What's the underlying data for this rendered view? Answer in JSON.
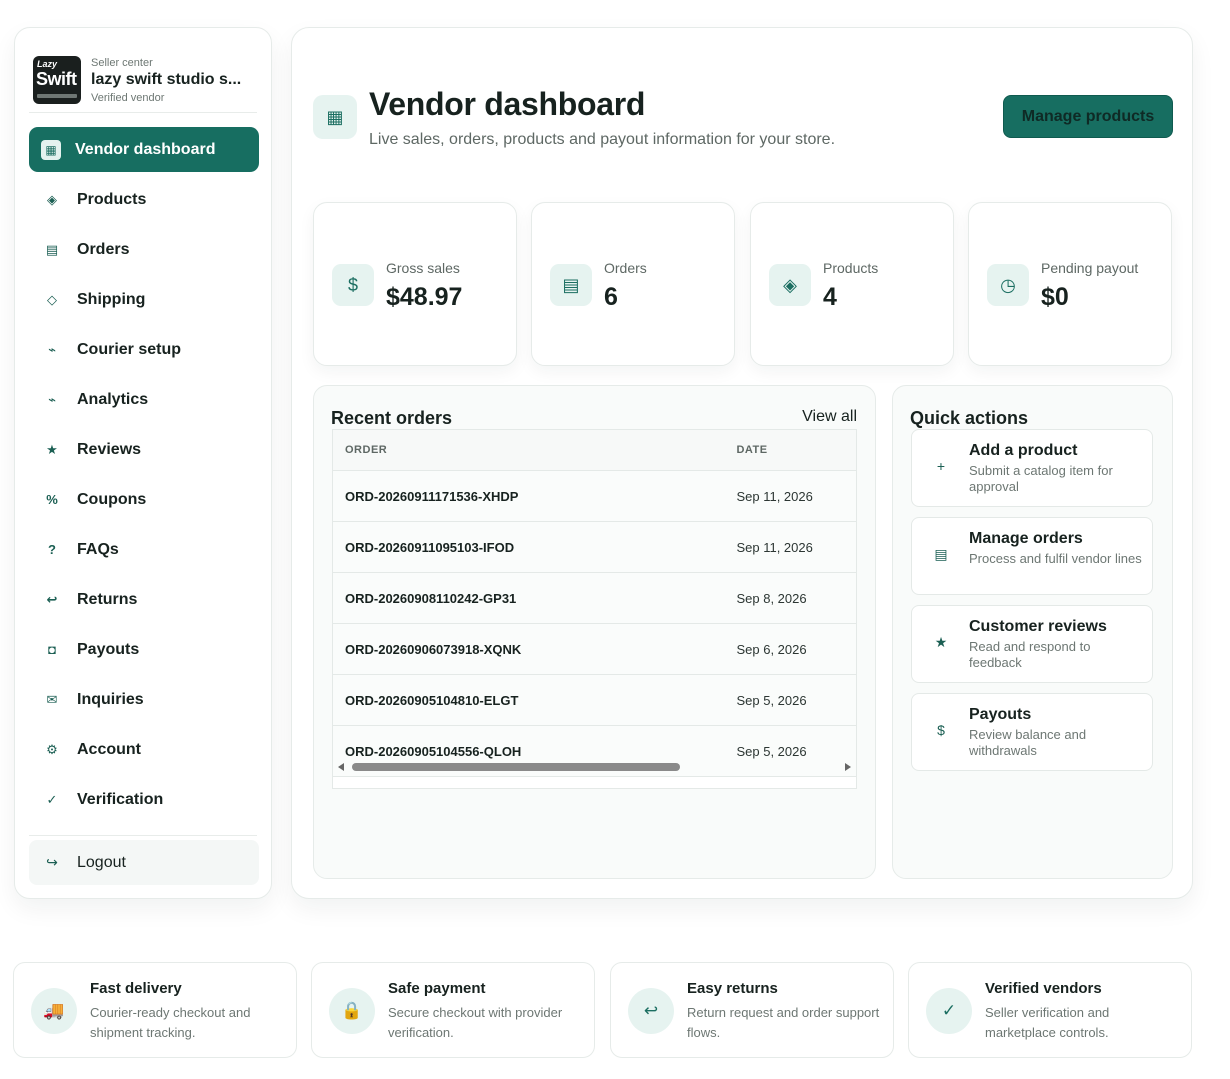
{
  "brand": {
    "logo_top": "Lazy",
    "logo_main": "Swift",
    "kicker": "Seller center",
    "name": "lazy swift studio s...",
    "status": "Verified vendor"
  },
  "sidebar": {
    "items": [
      {
        "label": "Vendor dashboard",
        "icon": "dashboard-icon",
        "glyph": "▦",
        "active": true
      },
      {
        "label": "Products",
        "icon": "diamond-icon",
        "glyph": "◈"
      },
      {
        "label": "Orders",
        "icon": "orders-icon",
        "glyph": "▤"
      },
      {
        "label": "Shipping",
        "icon": "shipping-icon",
        "glyph": "◇"
      },
      {
        "label": "Courier setup",
        "icon": "courier-icon",
        "glyph": "⌁"
      },
      {
        "label": "Analytics",
        "icon": "analytics-icon",
        "glyph": "⌁"
      },
      {
        "label": "Reviews",
        "icon": "star-icon",
        "glyph": "★"
      },
      {
        "label": "Coupons",
        "icon": "percent-icon",
        "glyph": "%"
      },
      {
        "label": "FAQs",
        "icon": "question-icon",
        "glyph": "?"
      },
      {
        "label": "Returns",
        "icon": "return-icon",
        "glyph": "↩"
      },
      {
        "label": "Payouts",
        "icon": "payout-icon",
        "glyph": "◘"
      },
      {
        "label": "Inquiries",
        "icon": "mail-icon",
        "glyph": "✉"
      },
      {
        "label": "Account",
        "icon": "gear-icon",
        "glyph": "⚙"
      },
      {
        "label": "Verification",
        "icon": "check-icon",
        "glyph": "✓"
      }
    ],
    "logout_label": "Logout",
    "logout_glyph": "↪"
  },
  "header": {
    "icon_glyph": "▦",
    "title": "Vendor dashboard",
    "subtitle": "Live sales, orders, products and payout information for your store.",
    "manage_button": "Manage products"
  },
  "stats": [
    {
      "label": "Gross sales",
      "value": "$48.97",
      "glyph": "$"
    },
    {
      "label": "Orders",
      "value": "6",
      "glyph": "▤"
    },
    {
      "label": "Products",
      "value": "4",
      "glyph": "◈"
    },
    {
      "label": "Pending payout",
      "value": "$0",
      "glyph": "◷"
    }
  ],
  "recent_orders": {
    "title": "Recent orders",
    "view_all": "View all",
    "columns": [
      "ORDER",
      "DATE"
    ],
    "rows": [
      {
        "order": "ORD-20260911171536-XHDP",
        "date": "Sep 11, 2026"
      },
      {
        "order": "ORD-20260911095103-IFOD",
        "date": "Sep 11, 2026"
      },
      {
        "order": "ORD-20260908110242-GP31",
        "date": "Sep 8, 2026"
      },
      {
        "order": "ORD-20260906073918-XQNK",
        "date": "Sep 6, 2026"
      },
      {
        "order": "ORD-20260905104810-ELGT",
        "date": "Sep 5, 2026"
      },
      {
        "order": "ORD-20260905104556-QLOH",
        "date": "Sep 5, 2026"
      }
    ]
  },
  "quick_actions": {
    "title": "Quick actions",
    "items": [
      {
        "title": "Add a product",
        "subtitle": "Submit a catalog item for approval",
        "glyph": "+",
        "icon": "plus-icon"
      },
      {
        "title": "Manage orders",
        "subtitle": "Process and fulfil vendor lines",
        "glyph": "▤",
        "icon": "orders-icon"
      },
      {
        "title": "Customer reviews",
        "subtitle": "Read and respond to feedback",
        "glyph": "★",
        "icon": "star-icon"
      },
      {
        "title": "Payouts",
        "subtitle": "Review balance and withdrawals",
        "glyph": "$",
        "icon": "dollar-icon"
      }
    ]
  },
  "features": [
    {
      "title": "Fast delivery",
      "subtitle": "Courier-ready checkout and shipment tracking.",
      "glyph": "🚚",
      "icon": "truck-icon"
    },
    {
      "title": "Safe payment",
      "subtitle": "Secure checkout with provider verification.",
      "glyph": "🔒",
      "icon": "lock-icon"
    },
    {
      "title": "Easy returns",
      "subtitle": "Return request and order support flows.",
      "glyph": "↩",
      "icon": "return-icon"
    },
    {
      "title": "Verified vendors",
      "subtitle": "Seller verification and marketplace controls.",
      "glyph": "✓",
      "icon": "check-icon"
    }
  ],
  "colors": {
    "accent": "#176e61",
    "accent_light": "#e6f3f0",
    "text": "#17221f",
    "muted": "#5e6864"
  }
}
